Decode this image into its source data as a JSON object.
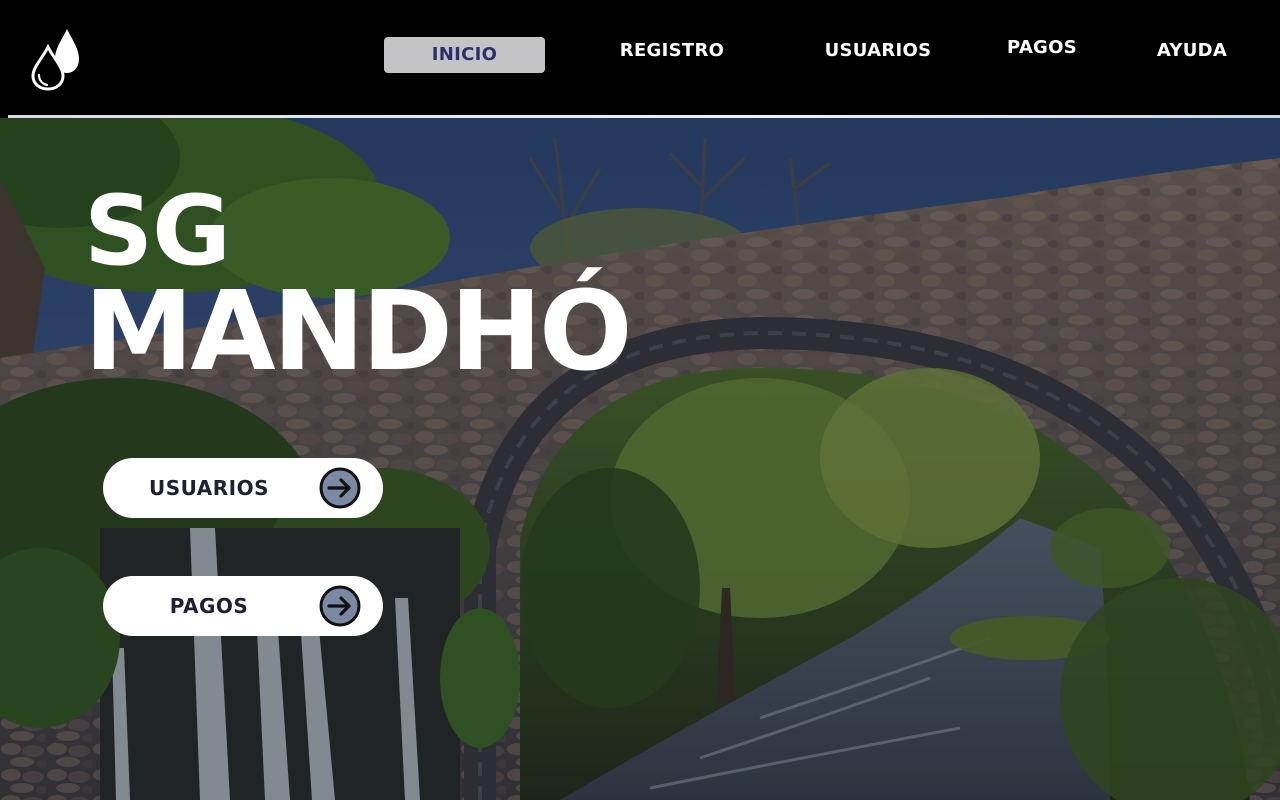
{
  "nav": {
    "items": [
      {
        "label": "INICIO",
        "active": true
      },
      {
        "label": "REGISTRO",
        "active": false
      },
      {
        "label": "USUARIOS",
        "active": false
      },
      {
        "label": "PAGOS",
        "active": false
      },
      {
        "label": "AYUDA",
        "active": false
      }
    ]
  },
  "logo": {
    "icon": "water-drops-icon"
  },
  "hero": {
    "title_line1": "SG",
    "title_line2": "MANDHÓ",
    "background": "stone-arch-bridge-over-river-photo",
    "buttons": [
      {
        "label": "USUARIOS",
        "icon": "arrow-right-circle-icon"
      },
      {
        "label": "PAGOS",
        "icon": "arrow-right-circle-icon"
      }
    ]
  },
  "colors": {
    "header_bg": "#000000",
    "active_tab_bg": "#c4c4c6",
    "active_tab_text": "#2e2f6a",
    "button_bg": "#ffffff",
    "button_text": "#1f2033",
    "arrow_fill": "#7b8aa3"
  }
}
